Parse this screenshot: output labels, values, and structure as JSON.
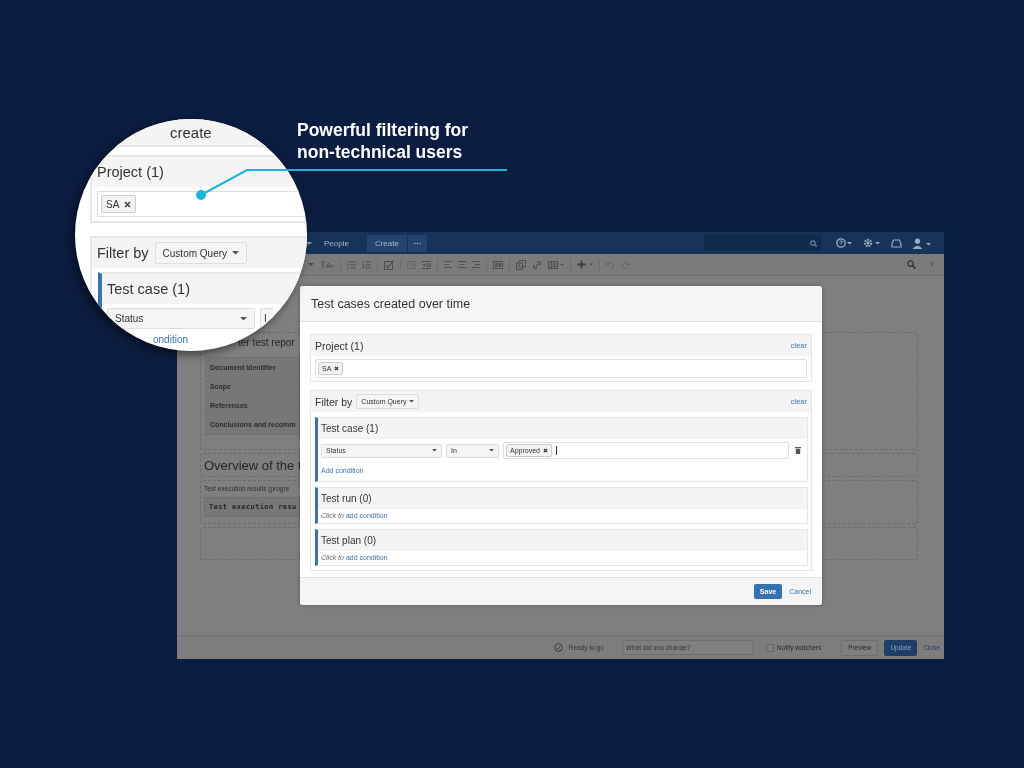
{
  "callout": {
    "text": "Powerful filtering for non-technical users"
  },
  "magnifier": {
    "title_fragment": "create",
    "project_label": "Project (1)",
    "tag": "SA",
    "filter_label": "Filter by",
    "query_button": "Custom Query",
    "group_title": "Test case (1)",
    "field": "Status",
    "operator_fragment": "I",
    "link_fragment": "ondition"
  },
  "editor": {
    "nav": {
      "link": "People",
      "create_button": "Create"
    },
    "toolbar": {
      "help_label": "?"
    },
    "document": {
      "heading_fragment": "ter test repor",
      "table_rows": [
        "Document identifier",
        "Scope",
        "References",
        "Conclusions and recomm"
      ],
      "section_heading": "Overview of the t",
      "macro_caption": "Test execution results (progre",
      "macro_title": "Test execution resu"
    },
    "footer": {
      "status": "Ready to go",
      "comment_placeholder": "What did you change?",
      "notify": {
        "label": "Notify watchers",
        "checked": false
      },
      "preview_button": "Preview",
      "update_button": "Update",
      "close_link": "Close"
    }
  },
  "dialog": {
    "title": "Test cases created over time",
    "project": {
      "label": "Project (1)",
      "clear": "clear",
      "tags": [
        "SA"
      ]
    },
    "filter": {
      "label": "Filter by",
      "mode": "Custom Query",
      "clear": "clear",
      "groups": [
        {
          "title": "Test case (1)",
          "conditions": [
            {
              "field": "Status",
              "operator": "In",
              "values": [
                "Approved"
              ]
            }
          ],
          "add_link": "Add condition"
        },
        {
          "title": "Test run (0)",
          "hint": "Click to",
          "add_link": "add condition"
        },
        {
          "title": "Test plan (0)",
          "hint": "Click to",
          "add_link": "add condition"
        }
      ]
    },
    "buttons": {
      "save": "Save",
      "cancel": "Cancel"
    }
  }
}
